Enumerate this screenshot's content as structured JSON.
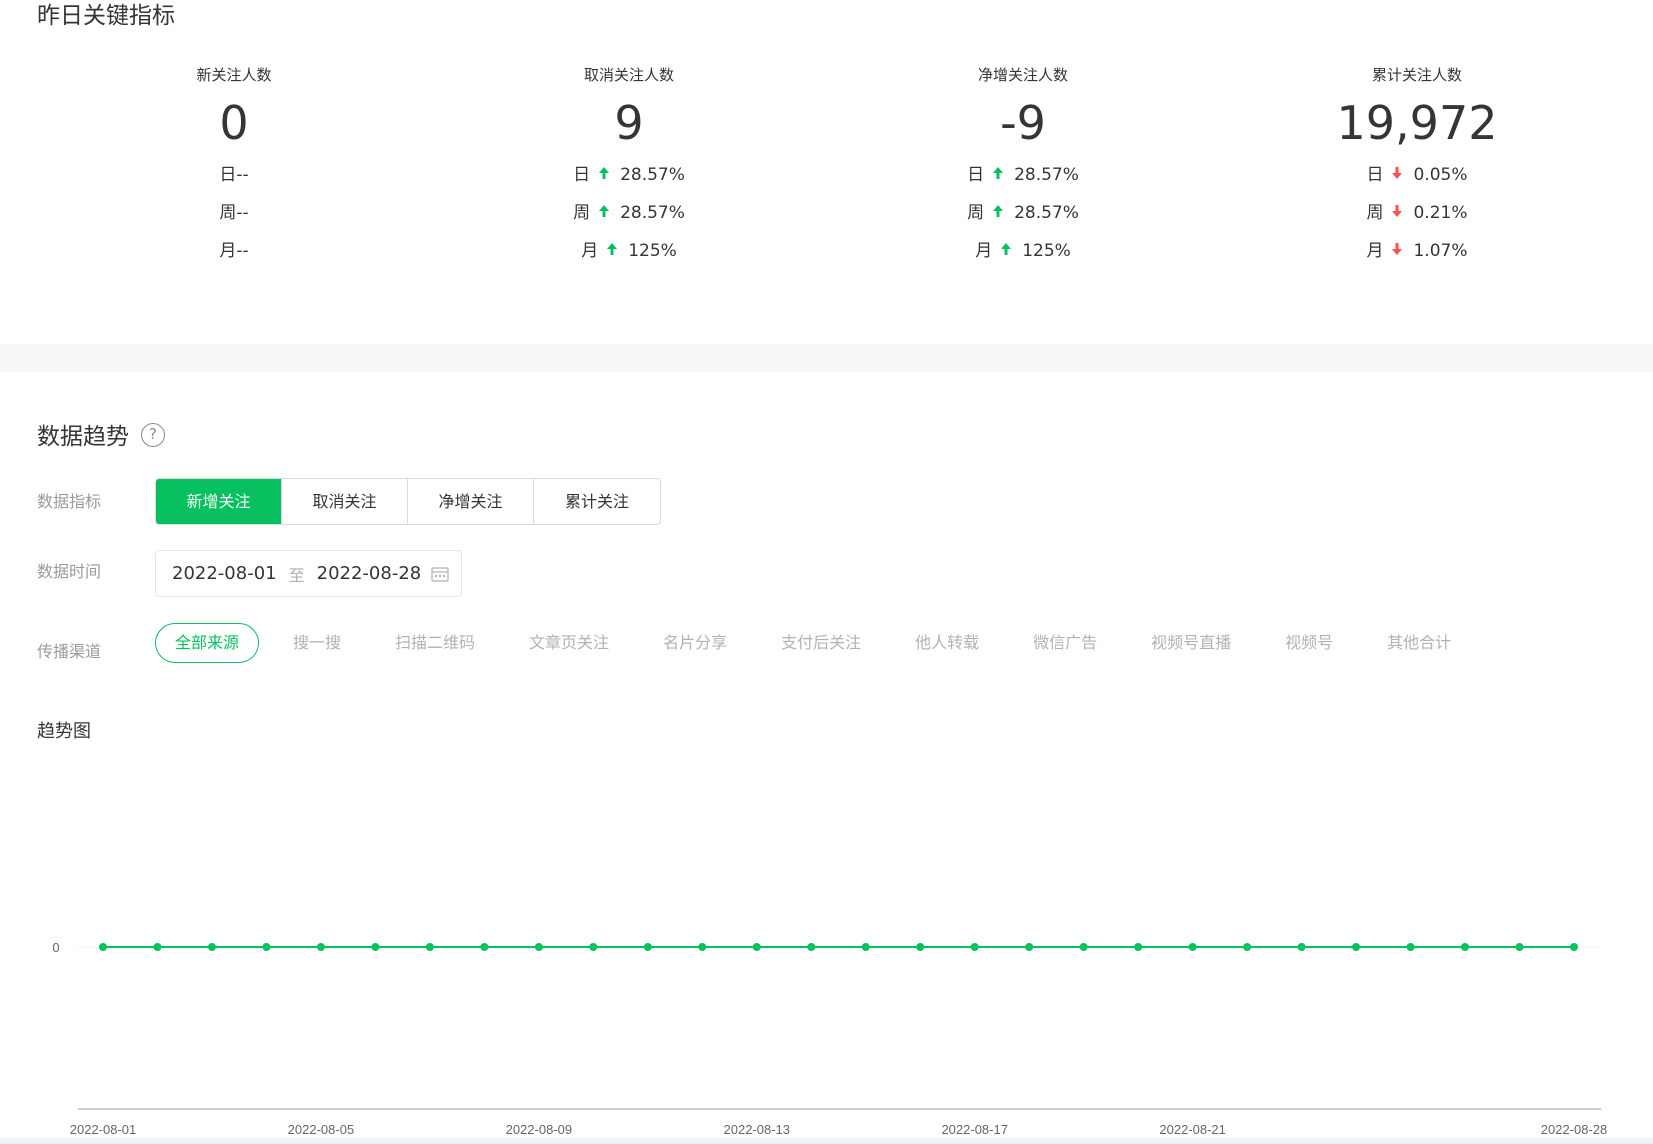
{
  "key_metrics": {
    "title": "昨日关键指标",
    "items": [
      {
        "label": "新关注人数",
        "value": "0",
        "rows": [
          {
            "key": "日",
            "change": "--",
            "dir": "none"
          },
          {
            "key": "周",
            "change": "--",
            "dir": "none"
          },
          {
            "key": "月",
            "change": "--",
            "dir": "none"
          }
        ]
      },
      {
        "label": "取消关注人数",
        "value": "9",
        "rows": [
          {
            "key": "日",
            "change": "28.57%",
            "dir": "up"
          },
          {
            "key": "周",
            "change": "28.57%",
            "dir": "up"
          },
          {
            "key": "月",
            "change": "125%",
            "dir": "up"
          }
        ]
      },
      {
        "label": "净增关注人数",
        "value": "-9",
        "rows": [
          {
            "key": "日",
            "change": "28.57%",
            "dir": "up"
          },
          {
            "key": "周",
            "change": "28.57%",
            "dir": "up"
          },
          {
            "key": "月",
            "change": "125%",
            "dir": "up"
          }
        ]
      },
      {
        "label": "累计关注人数",
        "value": "19,972",
        "rows": [
          {
            "key": "日",
            "change": "0.05%",
            "dir": "down"
          },
          {
            "key": "周",
            "change": "0.21%",
            "dir": "down"
          },
          {
            "key": "月",
            "change": "1.07%",
            "dir": "down"
          }
        ]
      }
    ]
  },
  "trend": {
    "title": "数据趋势",
    "help_icon": "question-circle-icon",
    "metric_label": "数据指标",
    "metric_tabs": [
      "新增关注",
      "取消关注",
      "净增关注",
      "累计关注"
    ],
    "metric_active": 0,
    "time_label": "数据时间",
    "date_start": "2022-08-01",
    "date_sep": "至",
    "date_end": "2022-08-28",
    "calendar_icon": "calendar-icon",
    "channel_label": "传播渠道",
    "channels": [
      "全部来源",
      "搜一搜",
      "扫描二维码",
      "文章页关注",
      "名片分享",
      "支付后关注",
      "他人转载",
      "微信广告",
      "视频号直播",
      "视频号",
      "其他合计"
    ],
    "channel_active": 0,
    "chart_title": "趋势图"
  },
  "colors": {
    "accent": "#07c160",
    "up": "#07c160",
    "down": "#fa5151"
  },
  "chart_data": {
    "type": "line",
    "x": [
      "2022-08-01",
      "2022-08-02",
      "2022-08-03",
      "2022-08-04",
      "2022-08-05",
      "2022-08-06",
      "2022-08-07",
      "2022-08-08",
      "2022-08-09",
      "2022-08-10",
      "2022-08-11",
      "2022-08-12",
      "2022-08-13",
      "2022-08-14",
      "2022-08-15",
      "2022-08-16",
      "2022-08-17",
      "2022-08-18",
      "2022-08-19",
      "2022-08-20",
      "2022-08-21",
      "2022-08-22",
      "2022-08-23",
      "2022-08-24",
      "2022-08-25",
      "2022-08-26",
      "2022-08-27",
      "2022-08-28"
    ],
    "series": [
      {
        "values": [
          0,
          0,
          0,
          0,
          0,
          0,
          0,
          0,
          0,
          0,
          0,
          0,
          0,
          0,
          0,
          0,
          0,
          0,
          0,
          0,
          0,
          0,
          0,
          0,
          0,
          0,
          0,
          0
        ]
      }
    ],
    "x_tick_labels": [
      "2022-08-01",
      "2022-08-05",
      "2022-08-09",
      "2022-08-13",
      "2022-08-17",
      "2022-08-21",
      "2022-08-28"
    ],
    "y_tick_labels": [
      "0"
    ],
    "grid": false,
    "color": "#07c160"
  }
}
